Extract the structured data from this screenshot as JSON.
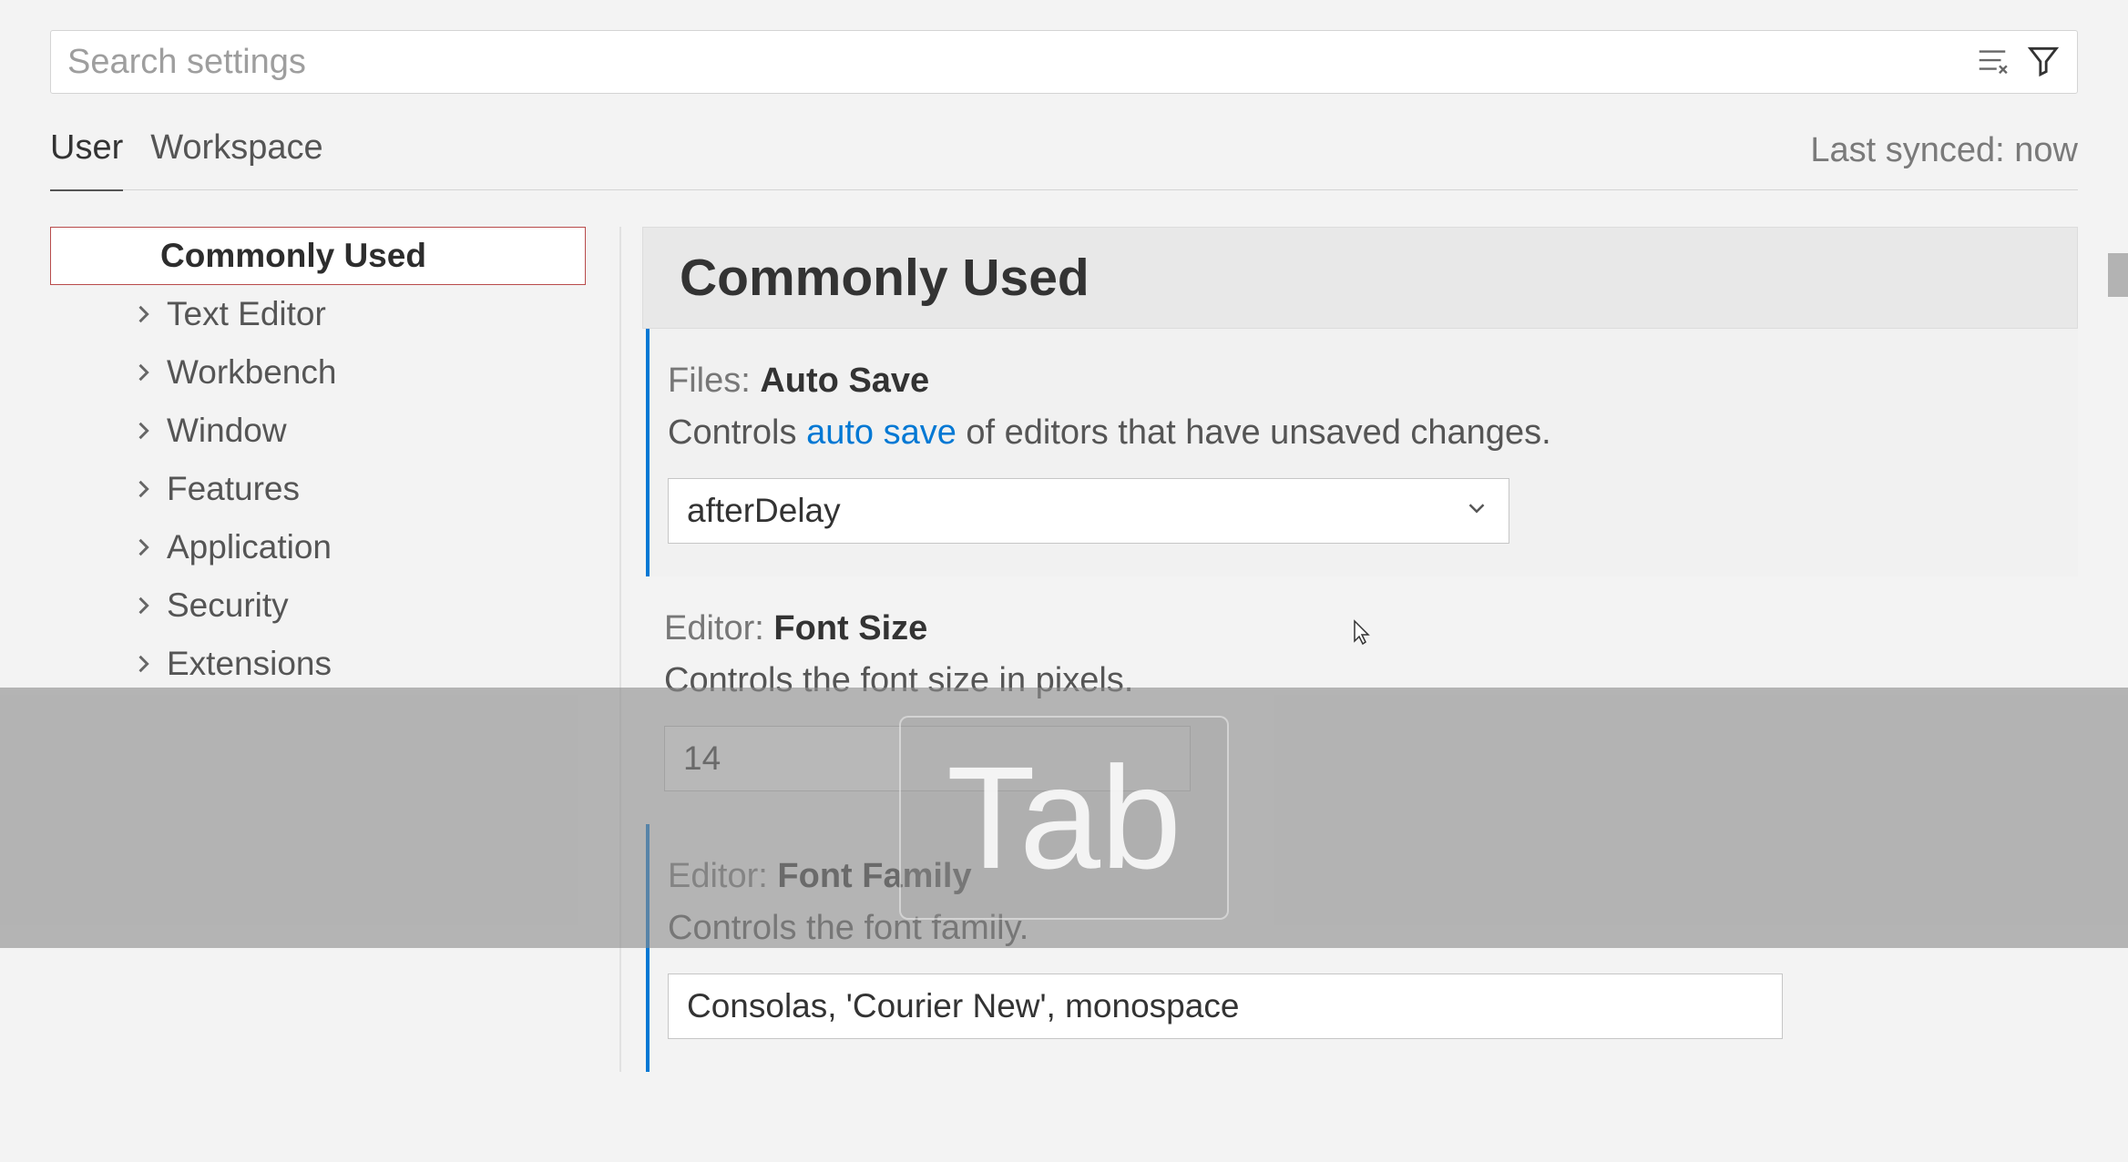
{
  "search": {
    "placeholder": "Search settings"
  },
  "tabs": {
    "user": "User",
    "workspace": "Workspace"
  },
  "sync_status": "Last synced: now",
  "sidebar": {
    "commonly_used": "Commonly Used",
    "text_editor": "Text Editor",
    "workbench": "Workbench",
    "window": "Window",
    "features": "Features",
    "application": "Application",
    "security": "Security",
    "extensions": "Extensions"
  },
  "content": {
    "header": "Commonly Used",
    "auto_save": {
      "scope": "Files: ",
      "name": "Auto Save",
      "desc_prefix": "Controls ",
      "desc_link": "auto save",
      "desc_suffix": " of editors that have unsaved changes.",
      "value": "afterDelay"
    },
    "font_size": {
      "scope": "Editor: ",
      "name": "Font Size",
      "desc": "Controls the font size in pixels.",
      "value": "14"
    },
    "font_family": {
      "scope": "Editor: ",
      "name": "Font Family",
      "desc": "Controls the font family.",
      "value": "Consolas, 'Courier New', monospace"
    }
  },
  "overlay": {
    "key": "Tab"
  }
}
